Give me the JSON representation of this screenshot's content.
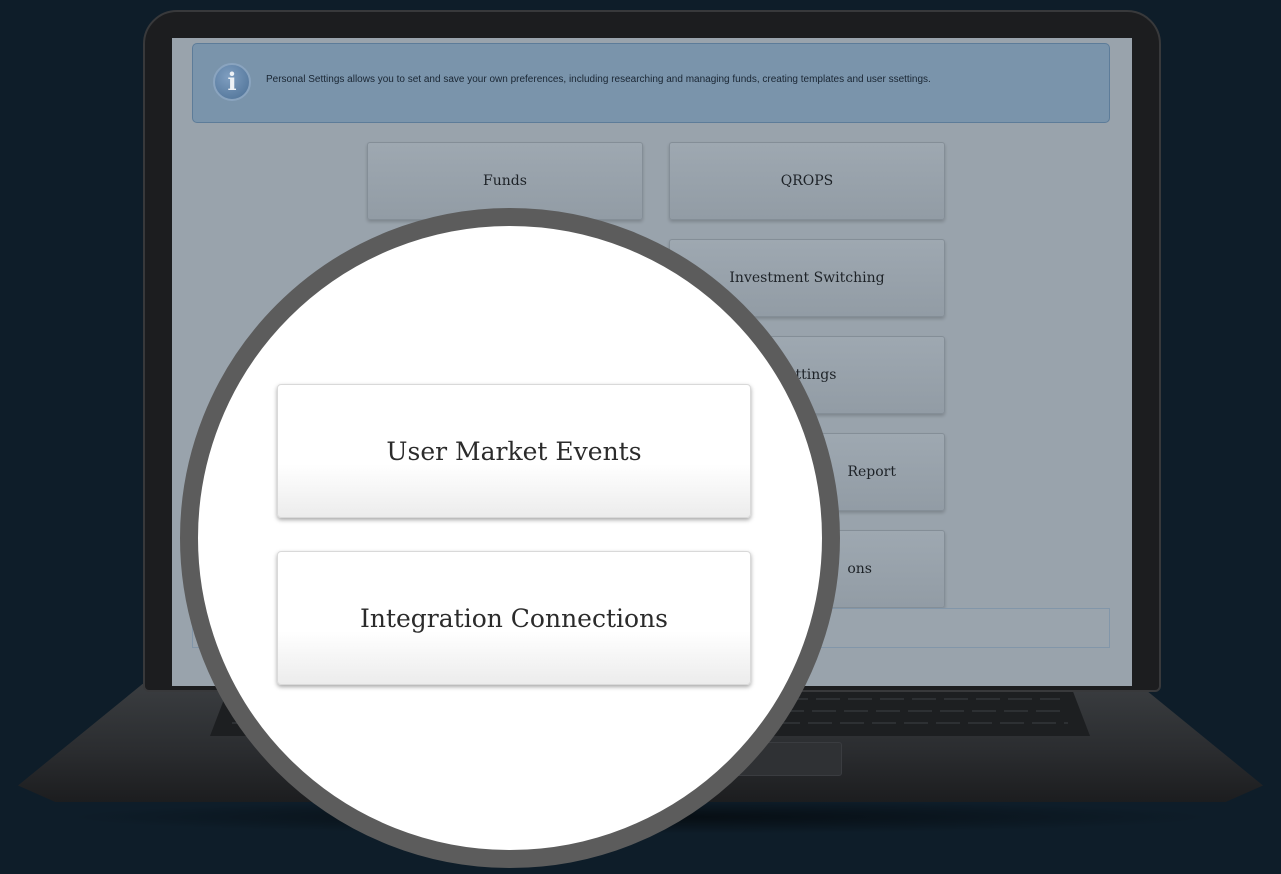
{
  "info_banner": {
    "icon": "info-icon",
    "text": "Personal Settings allows you to set and save your own preferences, including researching and managing funds, creating templates and user ssettings."
  },
  "tiles": {
    "funds": "Funds",
    "qrops": "QROPS",
    "investment_switching": "Investment Switching",
    "settings_partial": "Settings",
    "report_partial": "Report",
    "connections_partial": "ons"
  },
  "magnified": {
    "user_market_events": "User Market Events",
    "integration_connections": "Integration Connections"
  },
  "colors": {
    "background": "#0e1d29",
    "banner": "#7a94ab",
    "screen_overlay": "#99a3ac",
    "magnifier_ring": "#5c5c5c"
  }
}
